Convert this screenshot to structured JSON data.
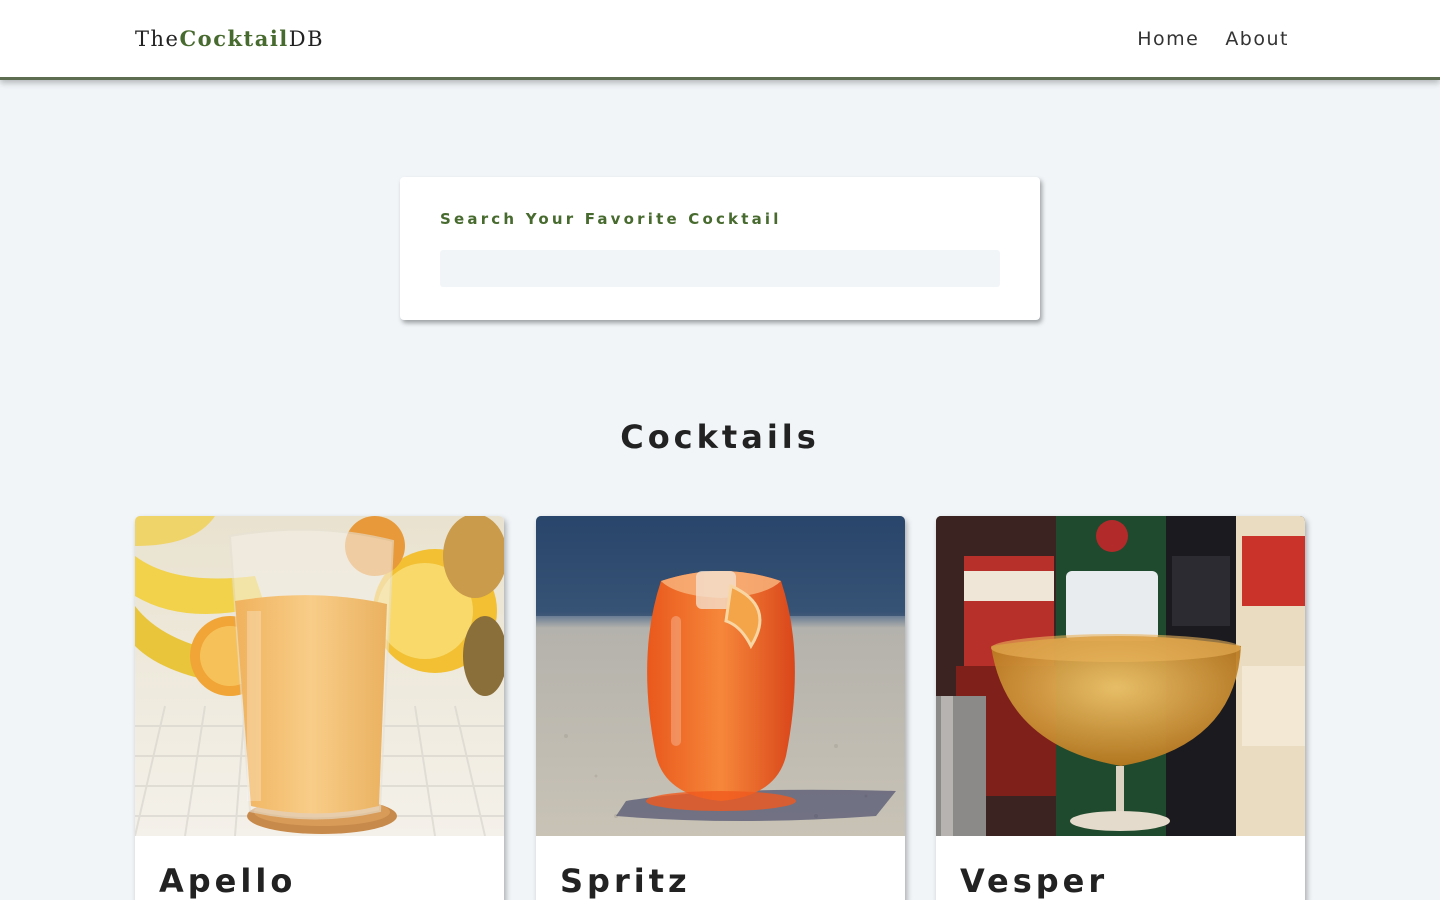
{
  "navbar": {
    "logo": {
      "prefix": "The",
      "middle": "Cocktail",
      "suffix": "DB"
    },
    "links": [
      {
        "label": "Home"
      },
      {
        "label": "About"
      }
    ]
  },
  "search": {
    "label": "Search Your Favorite Cocktail",
    "value": "",
    "placeholder": ""
  },
  "section": {
    "title": "Cocktails"
  },
  "cocktails": [
    {
      "name": "Apello",
      "image": "orange-juice-glass-photo"
    },
    {
      "name": "Spritz",
      "image": "spritz-glass-photo"
    },
    {
      "name": "Vesper",
      "image": "vesper-coupe-bottles-photo"
    }
  ],
  "colors": {
    "accent": "#476a2e",
    "nav_border": "#5c6e4f",
    "background": "#f1f5f8",
    "input_bg": "#f1f5f8"
  }
}
